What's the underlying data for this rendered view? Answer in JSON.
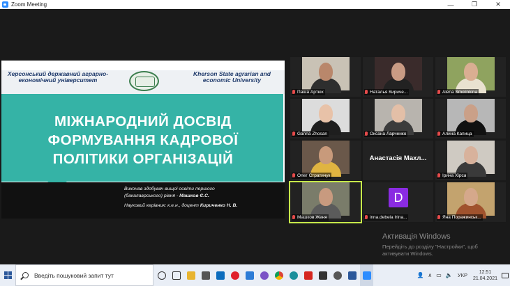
{
  "window": {
    "title": "Zoom Meeting",
    "controls": {
      "minimize": "—",
      "restore": "❐",
      "close": "✕"
    }
  },
  "slide": {
    "uni_left": "Херсонський державний аграрно-економічний університет",
    "uni_right": "Kherson State agrarian and economic University",
    "title": "МІЖНАРОДНИЙ ДОСВІД ФОРМУВАННЯ КАДРОВОЇ ПОЛІТИКИ ОРГАНІЗАЦІЙ",
    "author_line1": "Виконав здобувач вищої освіти першого",
    "author_line2": "(бакалаврського) рівня -",
    "author_name": "Машков Є.С.",
    "advisor_prefix": "Науковий керівник: к.е.н., доцент",
    "advisor_name": "Кириченко Н. В."
  },
  "participants": [
    {
      "name": "Паша Артюх",
      "muted": true,
      "face": "#b9876b",
      "body": "#2e2e2e",
      "bg": "#c9c2b5"
    },
    {
      "name": "Наталья Кириче...",
      "muted": true,
      "face": "#c99b84",
      "body": "#222",
      "bg": "#3a2b2b"
    },
    {
      "name": "Alena Smolinkina",
      "muted": true,
      "face": "#d9ae92",
      "body": "#e9e2d0",
      "bg": "#8fa35f"
    },
    {
      "name": "Ganna Zhosan",
      "muted": true,
      "face": "#e8c2a8",
      "body": "#1e1e1e",
      "bg": "#dcdcdc"
    },
    {
      "name": "Оксана Ларченко",
      "muted": true,
      "face": "#e3bfa7",
      "body": "#3c3c3c",
      "bg": "#b8b4ae"
    },
    {
      "name": "Алина Капица",
      "muted": true,
      "face": "#caa088",
      "body": "#111",
      "bg": "#b7b7b7"
    },
    {
      "name": "Олег Стратичук",
      "muted": true,
      "face": "#c89a7b",
      "body": "#e0b441",
      "bg": "#6a584a"
    },
    {
      "name": "",
      "big_label": "Анастасія Махл...",
      "muted": false
    },
    {
      "name": "Ірина Хірса",
      "muted": true,
      "face": "#d8b29c",
      "body": "#3a3a3a",
      "bg": "#cfcac2"
    },
    {
      "name": "Машков Женя",
      "muted": true,
      "face": "#c89a7f",
      "body": "#5b5b5b",
      "bg": "#7a7c6a",
      "active": true
    },
    {
      "name": "inna.debela Irina...",
      "muted": true,
      "avatar": "D"
    },
    {
      "name": "Яна Поражинськ...",
      "muted": true,
      "face": "#d5a88b",
      "body": "#a0522d",
      "bg": "#c3a36e"
    }
  ],
  "activation": {
    "title": "Активація Windows",
    "line1": "Перейдіть до розділу \"Настройки\", щоб",
    "line2": "активувати Windows."
  },
  "taskbar": {
    "search_placeholder": "Введіть пошуковий запит тут",
    "language": "УКР",
    "time": "12:51",
    "date": "21.04.2021"
  }
}
